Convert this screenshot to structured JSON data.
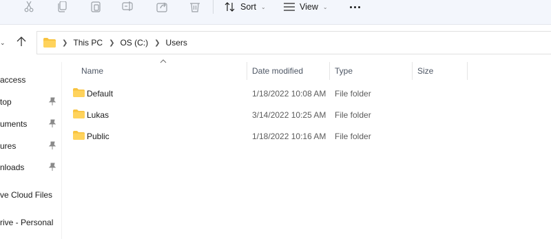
{
  "toolbar": {
    "icons": [
      "scissors-icon",
      "copy-icon",
      "paste-icon",
      "rename-icon",
      "share-icon",
      "delete-icon"
    ],
    "sort_label": "Sort",
    "view_label": "View"
  },
  "address": {
    "crumbs": [
      "This PC",
      "OS (C:)",
      "Users"
    ]
  },
  "sidebar": {
    "items": [
      {
        "label": "access",
        "pinned": false
      },
      {
        "label": "top",
        "pinned": true
      },
      {
        "label": "uments",
        "pinned": true
      },
      {
        "label": "ures",
        "pinned": true
      },
      {
        "label": "nloads",
        "pinned": true
      },
      {
        "label": "ve Cloud Files",
        "pinned": false
      },
      {
        "label": "rive - Personal",
        "pinned": false
      }
    ]
  },
  "columns": {
    "name": "Name",
    "date_modified": "Date modified",
    "type": "Type",
    "size": "Size"
  },
  "files": [
    {
      "name": "Default",
      "date_modified": "1/18/2022 10:08 AM",
      "type": "File folder"
    },
    {
      "name": "Lukas",
      "date_modified": "3/14/2022 10:25 AM",
      "type": "File folder"
    },
    {
      "name": "Public",
      "date_modified": "1/18/2022 10:16 AM",
      "type": "File folder"
    }
  ],
  "colors": {
    "toolbar_bg": "#f3f6fc",
    "folder_yellow": "#ffd35c",
    "header_text": "#4c5563"
  }
}
